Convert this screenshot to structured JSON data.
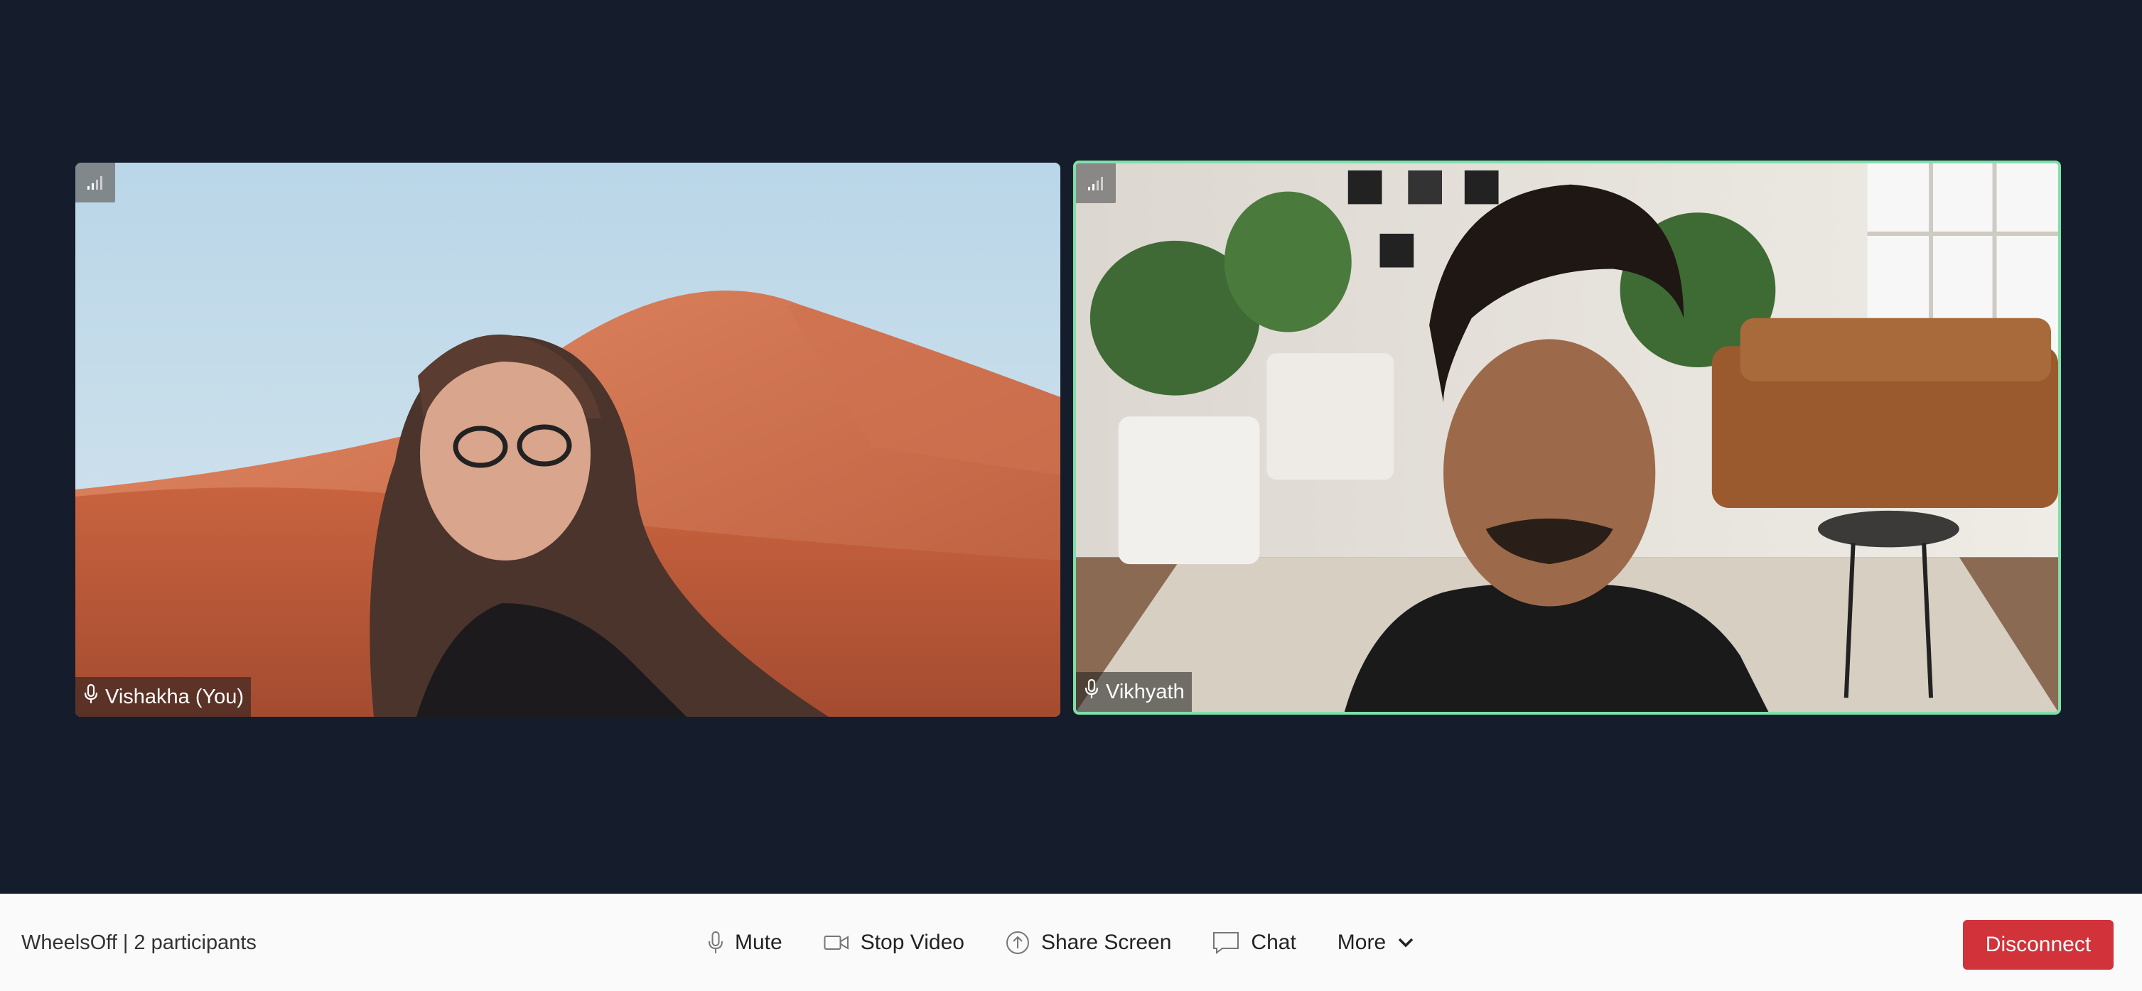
{
  "participants": [
    {
      "name": "Vishakha (You)",
      "mic_icon": "microphone-icon",
      "signal_icon": "signal-strength-icon"
    },
    {
      "name": "Vikhyath",
      "mic_icon": "microphone-icon",
      "signal_icon": "signal-strength-icon",
      "active_speaker": true
    }
  ],
  "room": {
    "name": "WheelsOff",
    "separator": "|",
    "participants_label": "2 participants"
  },
  "controls": {
    "mute": "Mute",
    "stop_video": "Stop Video",
    "share_screen": "Share Screen",
    "chat": "Chat",
    "more": "More"
  },
  "disconnect_label": "Disconnect",
  "colors": {
    "background": "#151c2c",
    "active_border": "#7ee0a8",
    "disconnect": "#d2323a",
    "toolbar": "#fafafa"
  }
}
